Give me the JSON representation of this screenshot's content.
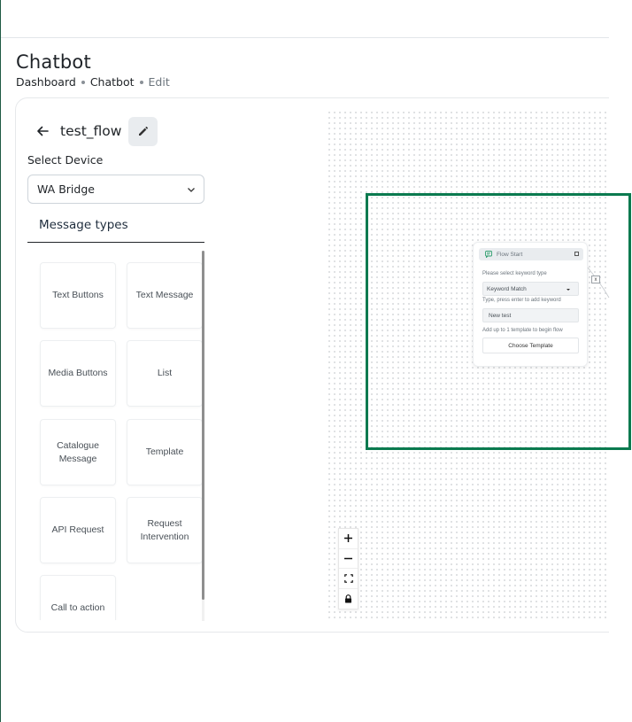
{
  "page": {
    "title": "Chatbot",
    "breadcrumb": [
      "Dashboard",
      "Chatbot",
      "Edit"
    ]
  },
  "flow": {
    "name": "test_flow",
    "back_icon": "arrow-left-icon",
    "edit_icon": "pencil-icon"
  },
  "device": {
    "label": "Select Device",
    "selected": "WA Bridge"
  },
  "tab": {
    "label": "Message types"
  },
  "message_types": [
    "Text Buttons",
    "Text Message",
    "Media Buttons",
    "List",
    "Catalogue Message",
    "Template",
    "API Request",
    "Request Intervention",
    "Call to action"
  ],
  "node": {
    "title": "Flow Start",
    "keyword_label": "Please select keyword type",
    "keyword_value": "Keyword Match",
    "hint": "Type, press enter to add keyword",
    "keyword_chip": "New test",
    "template_hint": "Add up to 1 template to begin flow",
    "choose_button": "Choose Template",
    "handle_label": "x"
  },
  "zoom_controls": [
    "zoom-in-icon",
    "zoom-out-icon",
    "fit-view-icon",
    "lock-icon"
  ],
  "colors": {
    "highlight": "#0b7a4f",
    "node_accent": "#2f9e6e"
  }
}
